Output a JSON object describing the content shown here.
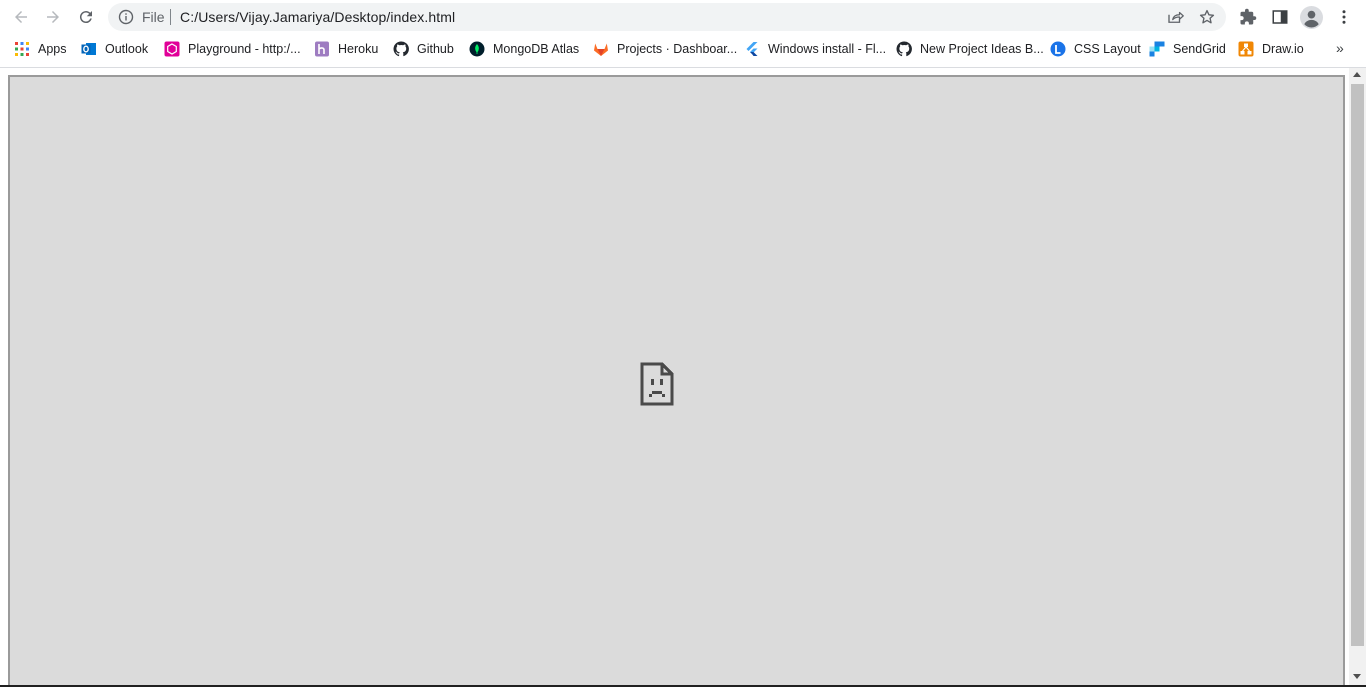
{
  "toolbar": {
    "back_icon": "arrow-left-icon",
    "forward_icon": "arrow-right-icon",
    "reload_icon": "reload-icon",
    "omnibox": {
      "scheme_label": "File",
      "url": "C:/Users/Vijay.Jamariya/Desktop/index.html"
    },
    "share_icon": "share-icon",
    "bookmark_star_icon": "star-icon",
    "extensions_icon": "puzzle-icon",
    "side_panel_icon": "side-panel-icon",
    "profile_icon": "profile-avatar-icon",
    "menu_icon": "kebab-menu-icon"
  },
  "bookmarks": [
    {
      "label": "Apps",
      "icon": "apps-grid-icon"
    },
    {
      "label": "Outlook",
      "icon": "outlook-icon"
    },
    {
      "label": "Playground - http:/...",
      "icon": "playground-icon"
    },
    {
      "label": "Heroku",
      "icon": "heroku-icon"
    },
    {
      "label": "Github",
      "icon": "github-icon"
    },
    {
      "label": "MongoDB Atlas",
      "icon": "mongodb-icon"
    },
    {
      "label": "Projects · Dashboar...",
      "icon": "gitlab-icon"
    },
    {
      "label": "Windows install - Fl...",
      "icon": "flutter-icon"
    },
    {
      "label": "New Project Ideas B...",
      "icon": "github-icon"
    },
    {
      "label": "CSS Layout",
      "icon": "css-layout-icon"
    },
    {
      "label": "SendGrid",
      "icon": "sendgrid-icon"
    },
    {
      "label": "Draw.io",
      "icon": "drawio-icon"
    }
  ],
  "bookmarks_overflow": "»",
  "content": {
    "frame_state": "sad-document-icon"
  },
  "colors": {
    "frame_bg": "#dbdbdb",
    "omnibox_bg": "#f1f3f4"
  }
}
